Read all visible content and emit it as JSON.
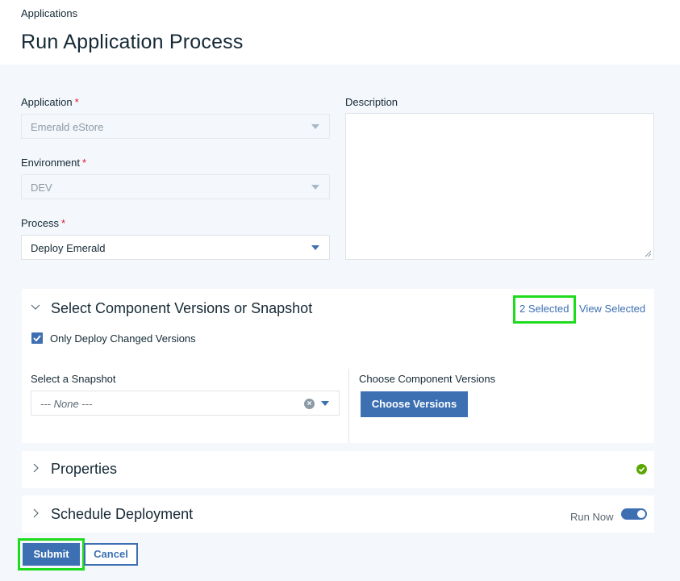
{
  "breadcrumb": "Applications",
  "page_title": "Run Application Process",
  "form": {
    "application": {
      "label": "Application",
      "required_mark": "*",
      "value": "Emerald eStore"
    },
    "environment": {
      "label": "Environment",
      "required_mark": "*",
      "value": "DEV"
    },
    "process": {
      "label": "Process",
      "required_mark": "*",
      "value": "Deploy Emerald"
    },
    "description": {
      "label": "Description",
      "value": ""
    }
  },
  "component_section": {
    "title": "Select Component Versions or Snapshot",
    "selected_count": "2 Selected",
    "view_selected": "View Selected",
    "only_changed_label": "Only Deploy Changed Versions",
    "only_changed_checked": true,
    "snapshot_label": "Select a Snapshot",
    "snapshot_value": "--- None ---",
    "choose_versions_label": "Choose Component Versions",
    "choose_versions_button": "Choose Versions"
  },
  "properties_section": {
    "title": "Properties",
    "status_icon": "check-circle-icon"
  },
  "schedule_section": {
    "title": "Schedule Deployment",
    "run_now_label": "Run Now",
    "run_now_on": true
  },
  "actions": {
    "submit": "Submit",
    "cancel": "Cancel"
  },
  "colors": {
    "accent": "#3d70b2",
    "required": "#e0182d",
    "success": "#5aa700",
    "highlight": "#1edb1e"
  }
}
